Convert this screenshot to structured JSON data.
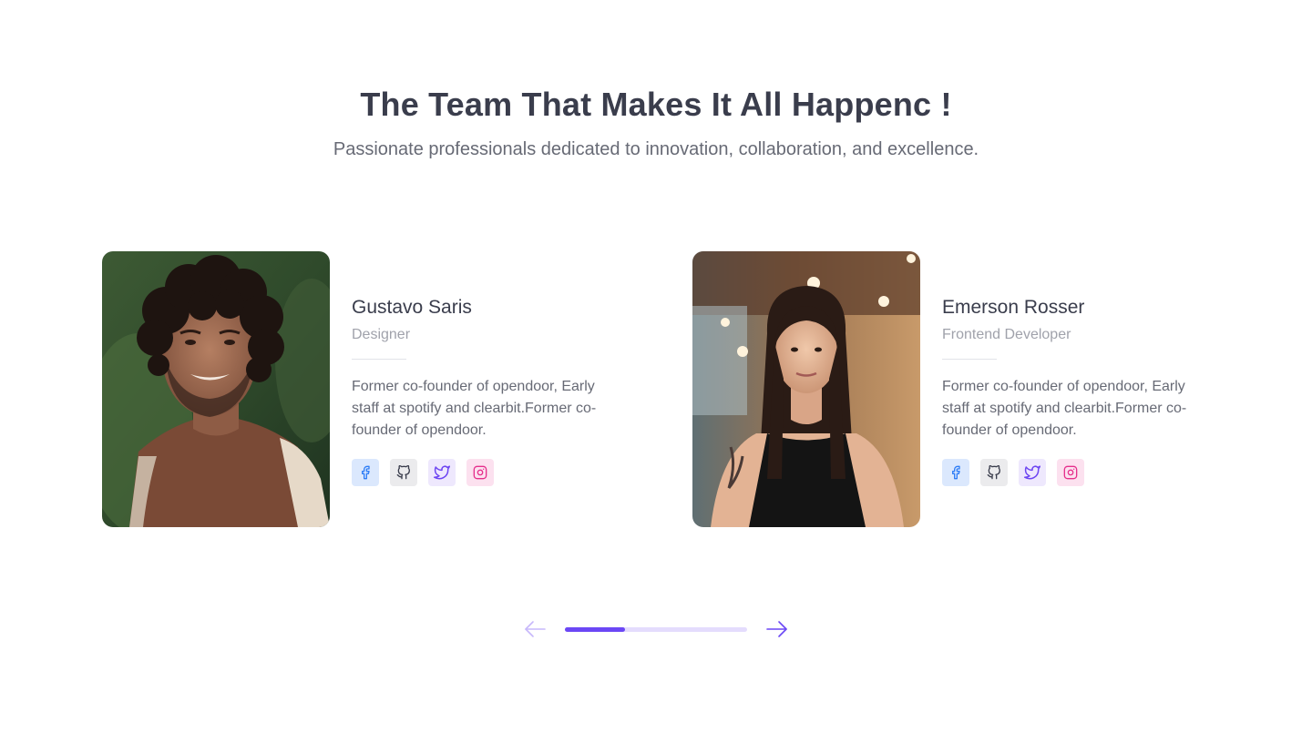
{
  "header": {
    "title": "The Team That Makes It All Happenc !",
    "subtitle": "Passionate professionals dedicated to innovation, collaboration, and excellence."
  },
  "team": [
    {
      "name": "Gustavo Saris",
      "role": "Designer",
      "bio": "Former co-founder of opendoor, Early staff at spotify and clearbit.Former co-founder of opendoor.",
      "photo": "man-curly-hair-brown-shirt-portrait",
      "socials": [
        "facebook-icon",
        "github-icon",
        "twitter-icon",
        "instagram-icon"
      ]
    },
    {
      "name": "Emerson Rosser",
      "role": "Frontend Developer",
      "bio": "Former co-founder of opendoor, Early staff at spotify and clearbit.Former co-founder of opendoor.",
      "photo": "woman-long-hair-black-top-portrait",
      "socials": [
        "facebook-icon",
        "github-icon",
        "twitter-icon",
        "instagram-icon"
      ]
    }
  ],
  "carousel": {
    "progress": 0.33,
    "prev_icon": "arrow-left-icon",
    "next_icon": "arrow-right-icon"
  },
  "colors": {
    "accent": "#6b47f5",
    "accent_light": "#e4dcfd",
    "heading": "#3a3d4c",
    "body": "#676a75",
    "muted": "#a0a2ab",
    "facebook": "#2f7ef6",
    "twitter": "#6d45f2",
    "instagram": "#e6308d"
  }
}
